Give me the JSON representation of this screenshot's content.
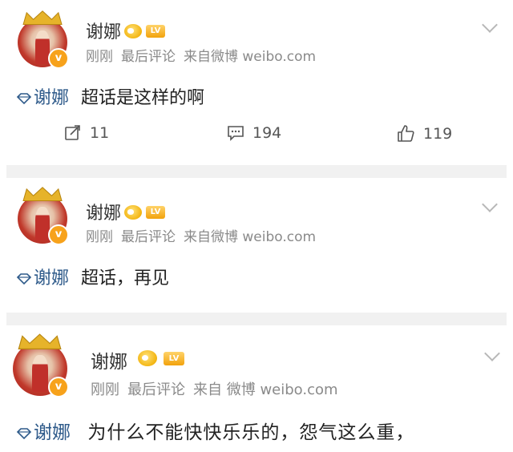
{
  "posts": [
    {
      "username": "谢娜",
      "level_badge": "LV",
      "meta": {
        "time": "刚刚",
        "activity": "最后评论",
        "source": "来自微博 weibo.com"
      },
      "content": {
        "topic": "谢娜",
        "text": "超话是这样的啊"
      },
      "actions": {
        "repost": "11",
        "comment": "194",
        "like": "119"
      }
    },
    {
      "username": "谢娜",
      "level_badge": "LV",
      "meta": {
        "time": "刚刚",
        "activity": "最后评论",
        "source": "来自微博 weibo.com"
      },
      "content": {
        "topic": "谢娜",
        "text": "超话，再见"
      }
    },
    {
      "username": "谢娜",
      "level_badge": "LV",
      "meta": {
        "time": "刚刚",
        "activity": "最后评论",
        "source": "来自 微博 weibo.com"
      },
      "content": {
        "topic": "谢娜",
        "text": "为什么不能快快乐乐的，怨气这么重，"
      }
    }
  ],
  "icons": {
    "avatar_verified": "v-badge-icon",
    "topic": "diamond-icon",
    "repost": "repost-icon",
    "comment": "comment-icon",
    "like": "thumbs-up-icon",
    "menu": "chevron-down-icon"
  },
  "colors": {
    "topic": "#2e5a8a",
    "verified": "#f7a21b",
    "muted": "#8a8a8a"
  }
}
